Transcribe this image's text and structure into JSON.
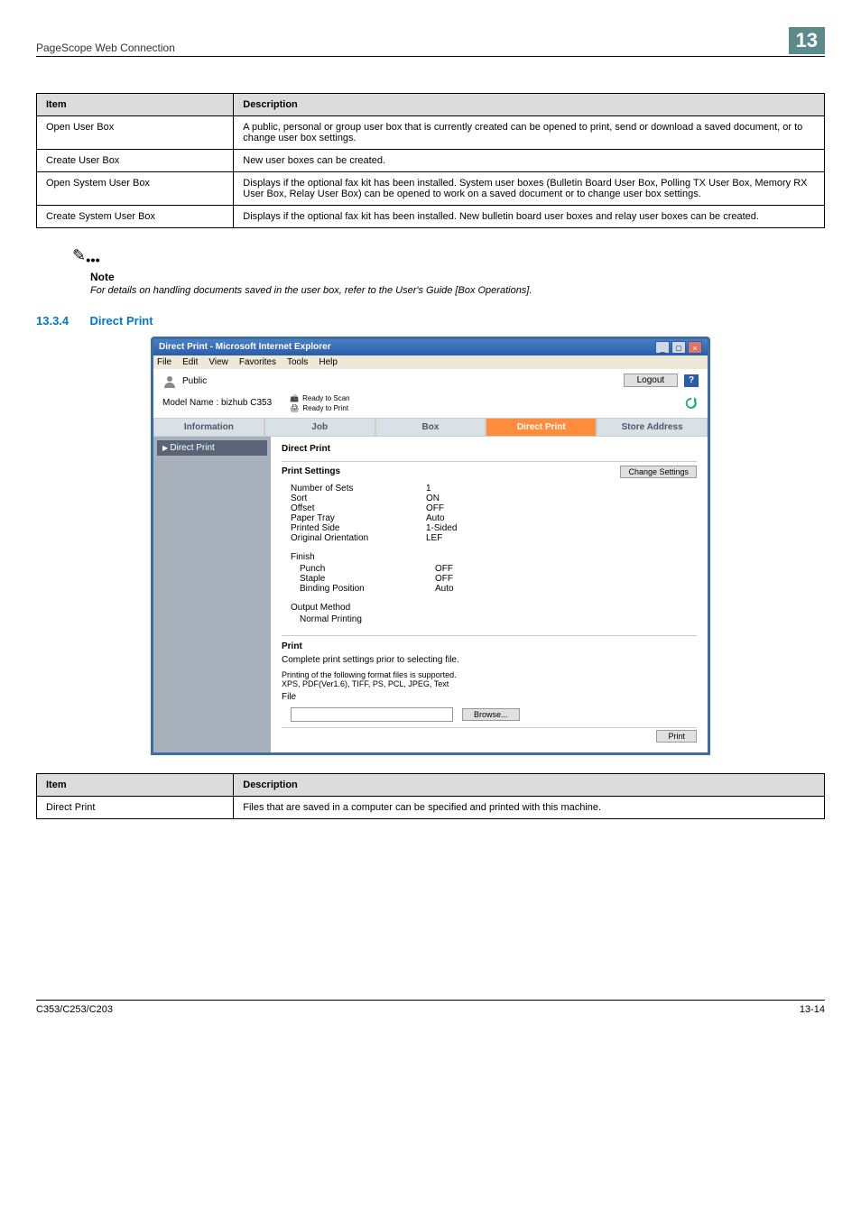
{
  "header": {
    "left": "PageScope Web Connection",
    "right": "13"
  },
  "table1": {
    "headers": [
      "Item",
      "Description"
    ],
    "rows": [
      [
        "Open User Box",
        "A public, personal or group user box that is currently created can be opened to print, send or download a saved document, or to change user box settings."
      ],
      [
        "Create User Box",
        "New user boxes can be created."
      ],
      [
        "Open System User Box",
        "Displays if the optional fax kit has been installed. System user boxes (Bulletin Board User Box, Polling TX User Box, Memory RX User Box, Relay User Box) can be opened to work on a saved document or to change user box settings."
      ],
      [
        "Create System User Box",
        "Displays if the optional fax kit has been installed. New bulletin board user boxes and relay user boxes can be created."
      ]
    ]
  },
  "note": {
    "label": "Note",
    "text": "For details on handling documents saved in the user box, refer to the User's Guide [Box Operations]."
  },
  "section": {
    "num": "13.3.4",
    "title": "Direct Print"
  },
  "browser": {
    "title": "Direct Print - Microsoft Internet Explorer",
    "menu": [
      "File",
      "Edit",
      "View",
      "Favorites",
      "Tools",
      "Help"
    ],
    "public": "Public",
    "logout": "Logout",
    "model": "Model Name : bizhub C353",
    "ready_scan": "Ready to Scan",
    "ready_print": "Ready to Print",
    "tabs": [
      "Information",
      "Job",
      "Box",
      "Direct Print",
      "Store Address"
    ],
    "sidebar_item": "Direct Print",
    "panel_title": "Direct Print",
    "print_settings_heading": "Print Settings",
    "change_settings": "Change Settings",
    "settings": [
      [
        "Number of Sets",
        "1"
      ],
      [
        "Sort",
        "ON"
      ],
      [
        "Offset",
        "OFF"
      ],
      [
        "Paper Tray",
        "Auto"
      ],
      [
        "Printed Side",
        "1-Sided"
      ],
      [
        "Original Orientation",
        "LEF"
      ]
    ],
    "finish_heading": "Finish",
    "finish": [
      [
        "Punch",
        "OFF"
      ],
      [
        "Staple",
        "OFF"
      ],
      [
        "Binding Position",
        "Auto"
      ]
    ],
    "output_heading": "Output Method",
    "output_value": "Normal Printing",
    "print_heading": "Print",
    "print_text1": "Complete print settings prior to selecting file.",
    "print_text2": "Printing of the following format files is supported.",
    "print_text3": "XPS, PDF(Ver1.6), TIFF, PS, PCL, JPEG, Text",
    "file_label": "File",
    "browse": "Browse...",
    "print_btn": "Print"
  },
  "table2": {
    "headers": [
      "Item",
      "Description"
    ],
    "rows": [
      [
        "Direct Print",
        "Files that are saved in a computer can be specified and printed with this machine."
      ]
    ]
  },
  "footer": {
    "left": "C353/C253/C203",
    "right": "13-14"
  }
}
